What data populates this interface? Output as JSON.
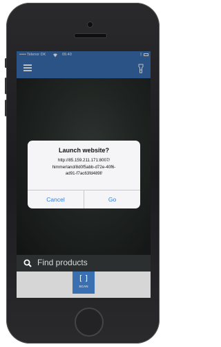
{
  "status_bar": {
    "carrier": "••••• Telenor DK",
    "wifi_icon": "wifi-icon",
    "time": "09.40",
    "bluetooth_icon": "bluetooth-icon",
    "battery_icon": "battery-icon"
  },
  "app_bar": {
    "menu_icon": "hamburger-menu-icon",
    "flashlight_icon": "flashlight-icon",
    "color": "#3a6fb2"
  },
  "dialog": {
    "title": "Launch website?",
    "message_lines": [
      "http://85.159.211.171:8007/",
      "himmerland/8d0f5abb-d72e-40f6-",
      "ad91-f7ac63fd489f/"
    ],
    "cancel_label": "Cancel",
    "go_label": "Go",
    "button_color": "#2f7de1"
  },
  "search": {
    "placeholder": "Find products",
    "icon": "search-icon"
  },
  "tab_bar": {
    "scan_icon": "scan-brackets-icon",
    "scan_glyph": "[ ]",
    "scan_label": "SCAN"
  }
}
